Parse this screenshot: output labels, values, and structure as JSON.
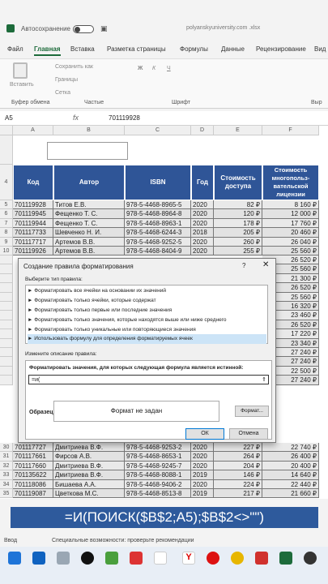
{
  "titlebar": {
    "autosave": "Автосохранение",
    "file": "polyanskyuniversity.com .xlsx"
  },
  "tabs": [
    "Файл",
    "Главная",
    "Вставка",
    "Разметка страницы",
    "Формулы",
    "Данные",
    "Рецензирование",
    "Вид"
  ],
  "ribbon": {
    "paste": "Вставить",
    "save_as": "Сохранить как",
    "borders": "Границы",
    "erase": "Сетка",
    "grp_clipboard": "Буфер обмена",
    "grp_show": "Частые",
    "grp_font": "Шрифт",
    "grp_align": "Выр"
  },
  "formula_bar": {
    "namebox": "A5",
    "fx": "fx",
    "value": "701119928"
  },
  "columns": [
    "A",
    "B",
    "C",
    "D",
    "E",
    "F"
  ],
  "headers": {
    "code": "Код",
    "author": "Автор",
    "isbn": "ISBN",
    "year": "Год",
    "price": "Стоимость доступа",
    "multi": "Стоимость многопольз-вательской лицензии"
  },
  "rows": [
    {
      "n": "5",
      "a": "701119928",
      "b": "Титов Е.В.",
      "c": "978-5-4468-8965-5",
      "d": "2020",
      "e": "82 ₽",
      "f": "8 160 ₽"
    },
    {
      "n": "6",
      "a": "701119945",
      "b": "Фещенко Т. С.",
      "c": "978-5-4468-8964-8",
      "d": "2020",
      "e": "120 ₽",
      "f": "12 000 ₽"
    },
    {
      "n": "7",
      "a": "701119944",
      "b": "Фещенко Т. С.",
      "c": "978-5-4468-8963-1",
      "d": "2020",
      "e": "178 ₽",
      "f": "17 760 ₽"
    },
    {
      "n": "8",
      "a": "701117733",
      "b": "Шевченко Н. И.",
      "c": "978-5-4468-6244-3",
      "d": "2018",
      "e": "205 ₽",
      "f": "20 460 ₽"
    },
    {
      "n": "9",
      "a": "701117717",
      "b": "Артемов В.В.",
      "c": "978-5-4468-9252-5",
      "d": "2020",
      "e": "260 ₽",
      "f": "26 040 ₽"
    },
    {
      "n": "10",
      "a": "701119926",
      "b": "Артемов В.В.",
      "c": "978-5-4468-8404-9",
      "d": "2020",
      "e": "255 ₽",
      "f": "25 560 ₽"
    }
  ],
  "side_values": [
    "26 520 ₽",
    "25 560 ₽",
    "21 300 ₽",
    "26 520 ₽",
    "25 560 ₽",
    "16 320 ₽",
    "23 460 ₽",
    "26 520 ₽",
    "17 220 ₽",
    "23 340 ₽",
    "27 240 ₽",
    "27 240 ₽",
    "22 500 ₽",
    "27 240 ₽"
  ],
  "bottom_rows": [
    {
      "n": "30",
      "a": "701117727",
      "b": "Дмитриева В.Ф.",
      "c": "978-5-4468-9253-2",
      "d": "2020",
      "e": "227 ₽",
      "f": "22 740 ₽"
    },
    {
      "n": "31",
      "a": "701117661",
      "b": "Фирсов А.В.",
      "c": "978-5-4468-8653-1",
      "d": "2020",
      "e": "264 ₽",
      "f": "26 400 ₽"
    },
    {
      "n": "32",
      "a": "701117660",
      "b": "Дмитриева В.Ф.",
      "c": "978-5-4468-9245-7",
      "d": "2020",
      "e": "204 ₽",
      "f": "20 400 ₽"
    },
    {
      "n": "33",
      "a": "701135622",
      "b": "Дмитриева В.Ф.",
      "c": "978-5-4468-8088-1",
      "d": "2019",
      "e": "146 ₽",
      "f": "14 640 ₽"
    },
    {
      "n": "34",
      "a": "701118086",
      "b": "Бишаева А.А.",
      "c": "978-5-4468-9406-2",
      "d": "2020",
      "e": "224 ₽",
      "f": "22 440 ₽"
    },
    {
      "n": "35",
      "a": "701119087",
      "b": "Цветкова М.С.",
      "c": "978-5-4468-8513-8",
      "d": "2019",
      "e": "217 ₽",
      "f": "21 660 ₽"
    }
  ],
  "dialog": {
    "title": "Создание правила форматирования",
    "help": "?",
    "select_label": "Выберите тип правила:",
    "rules": [
      "► Форматировать все ячейки на основании их значений",
      "► Форматировать только ячейки, которые содержат",
      "► Форматировать только первые или последние значения",
      "► Форматировать только значения, которые находятся выше или ниже среднего",
      "► Форматировать только уникальные или повторяющиеся значения",
      "► Использовать формулу для определения форматируемых ячеек"
    ],
    "desc_label": "Измените описание правила:",
    "formula_label": "Форматировать значения, для которых следующая формула является истинной:",
    "formula_value": "=и(",
    "preview_label": "Образец:",
    "preview_text": "Формат не задан",
    "format_button": "Формат...",
    "ok": "ОК",
    "cancel": "Отмена"
  },
  "overlay_formula": "=И(ПОИСК($B$2;A5);$B$2<>\"\")",
  "status": {
    "ready": "Ввод",
    "accessibility": "Специальные возможности: проверьте рекомендации"
  },
  "colors": {
    "header_blue": "#2f5597",
    "excel_green": "#1d6b3b",
    "overlay": "#2e5a9c"
  }
}
